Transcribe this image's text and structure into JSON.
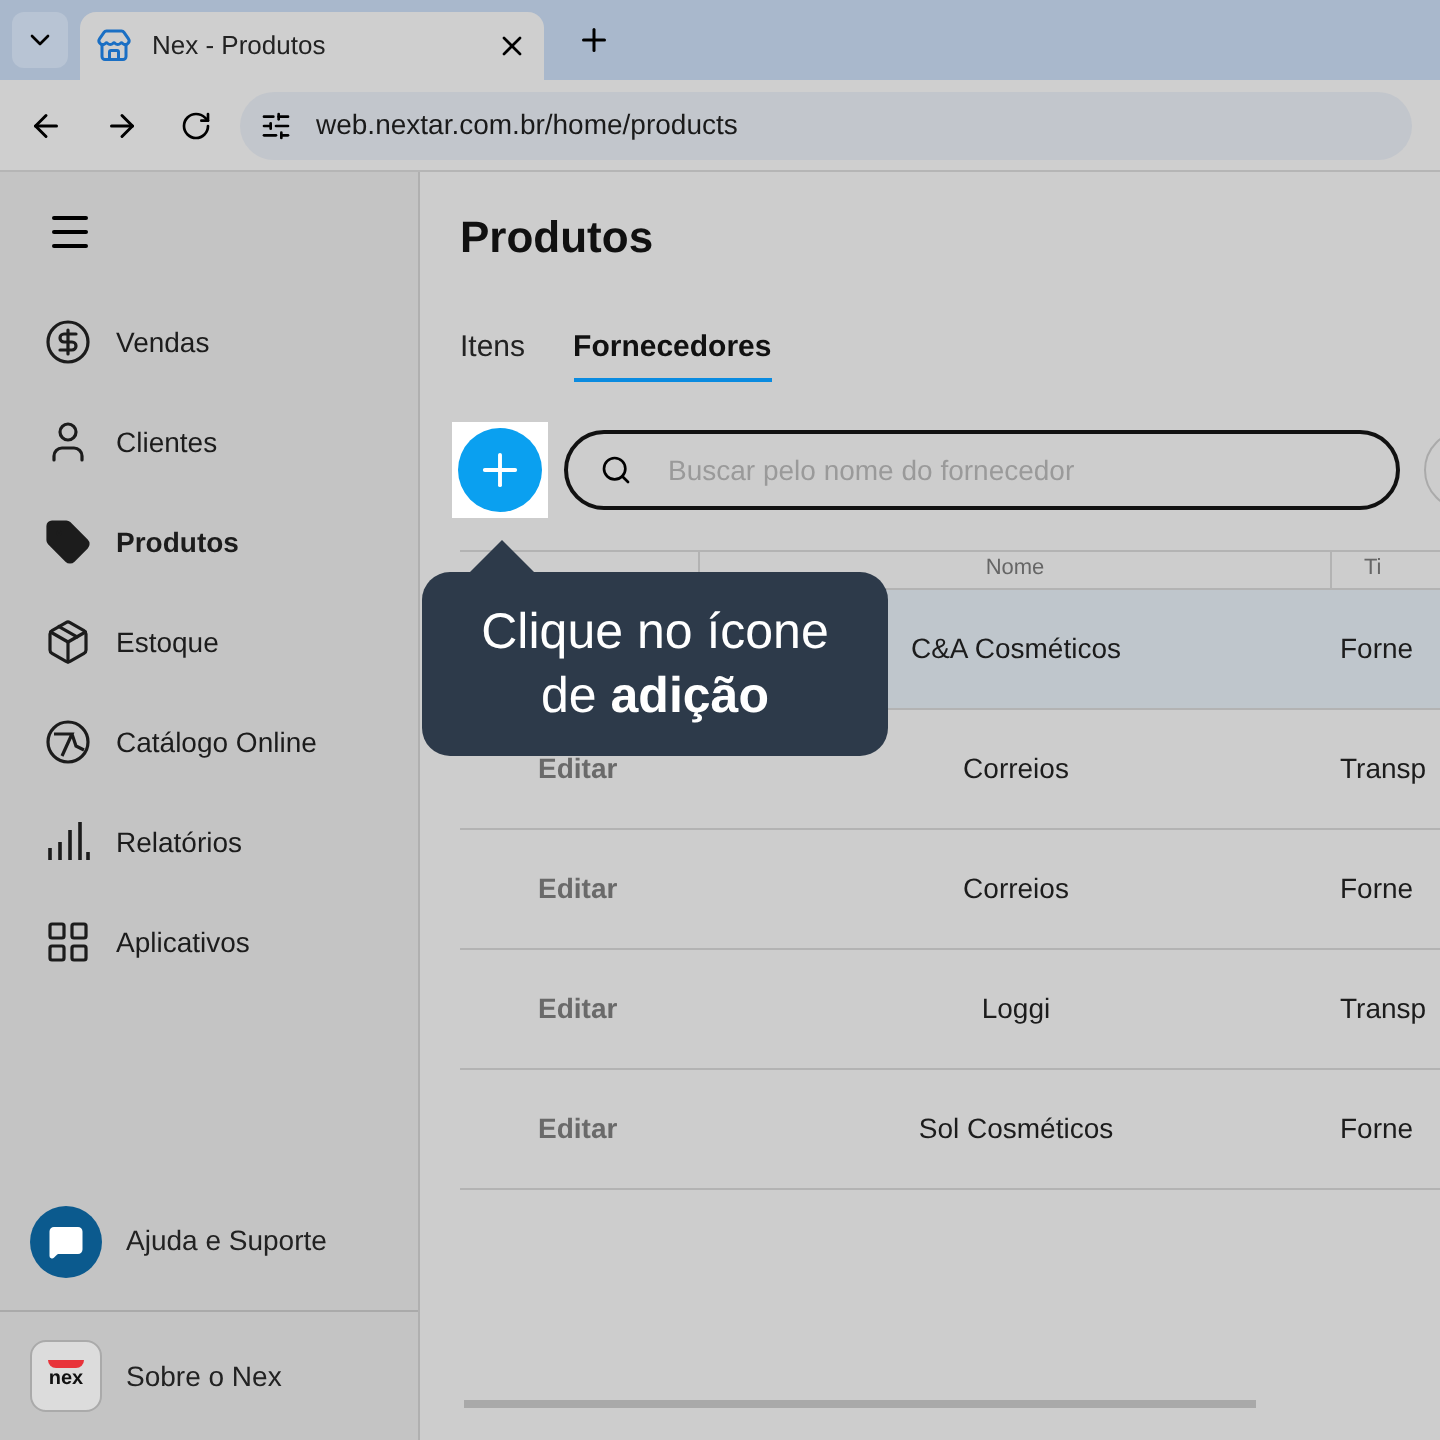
{
  "browser": {
    "tab_title": "Nex - Produtos",
    "url": "web.nextar.com.br/home/products"
  },
  "sidebar": {
    "items": [
      {
        "label": "Vendas",
        "kind": "dollar",
        "selected": false
      },
      {
        "label": "Clientes",
        "kind": "user",
        "selected": false
      },
      {
        "label": "Produtos",
        "kind": "tag",
        "selected": true
      },
      {
        "label": "Estoque",
        "kind": "box",
        "selected": false
      },
      {
        "label": "Catálogo Online",
        "kind": "catalog",
        "selected": false
      },
      {
        "label": "Relatórios",
        "kind": "bars",
        "selected": false
      },
      {
        "label": "Aplicativos",
        "kind": "grid",
        "selected": false
      }
    ],
    "help": "Ajuda e Suporte",
    "about": "Sobre o Nex",
    "logo_text": "nex"
  },
  "page": {
    "title": "Produtos",
    "tabs": [
      {
        "label": "Itens",
        "selected": false
      },
      {
        "label": "Fornecedores",
        "selected": true
      }
    ],
    "search": {
      "placeholder": "Buscar pelo nome do fornecedor"
    }
  },
  "table": {
    "columns": [
      "Nome",
      "Ti"
    ],
    "rows": [
      {
        "edit": null,
        "name": "C&A Cosméticos",
        "column_3": "Forne",
        "selected": true
      },
      {
        "edit": "Editar",
        "name": "Correios",
        "column_3": "Transp",
        "selected": false
      },
      {
        "edit": "Editar",
        "name": "Correios",
        "column_3": "Forne",
        "selected": false
      },
      {
        "edit": "Editar",
        "name": "Loggi",
        "column_3": "Transp",
        "selected": false
      },
      {
        "edit": "Editar",
        "name": "Sol Cosméticos",
        "column_3": "Forne",
        "selected": false
      }
    ]
  },
  "tooltip": "Clique no ícone de **adição**"
}
